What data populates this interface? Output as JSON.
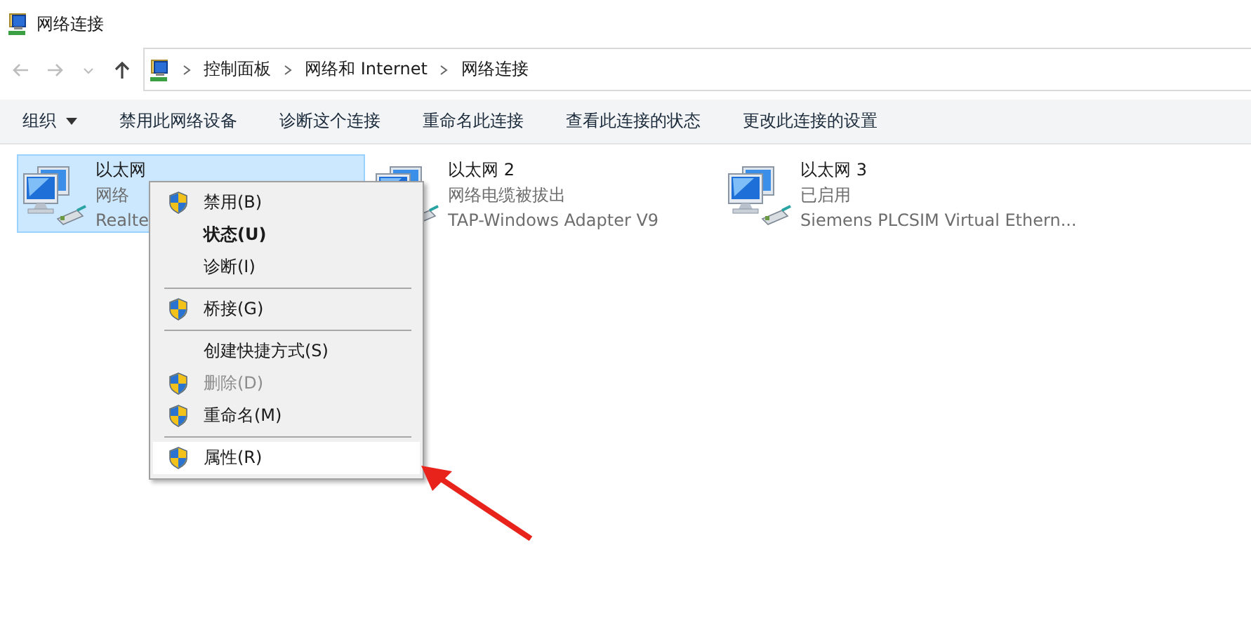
{
  "window": {
    "title": "网络连接"
  },
  "nav": [
    {
      "kind": "back",
      "disabled": true
    },
    {
      "kind": "forward",
      "disabled": true
    },
    {
      "kind": "recent",
      "disabled": true
    },
    {
      "kind": "up",
      "disabled": false
    }
  ],
  "address": {
    "segments": [
      "控制面板",
      "网络和 Internet",
      "网络连接"
    ]
  },
  "toolbar": [
    {
      "label": "组织",
      "kind": "menu"
    },
    {
      "label": "禁用此网络设备",
      "kind": "button"
    },
    {
      "label": "诊断这个连接",
      "kind": "button"
    },
    {
      "label": "重命名此连接",
      "kind": "button"
    },
    {
      "label": "查看此连接的状态",
      "kind": "button"
    },
    {
      "label": "更改此连接的设置",
      "kind": "button"
    }
  ],
  "connections": [
    {
      "name": "以太网",
      "status": "网络",
      "adapter": "Realte",
      "selected": true
    },
    {
      "name": "以太网 2",
      "status": "网络电缆被拔出",
      "adapter": "TAP-Windows Adapter V9",
      "selected": false
    },
    {
      "name": "以太网 3",
      "status": "已启用",
      "adapter": "Siemens PLCSIM Virtual Ethern...",
      "selected": false
    }
  ],
  "context_menu": {
    "items": [
      {
        "kind": "item",
        "label": "禁用(B)",
        "shield": true,
        "bold": false,
        "disabled": false,
        "selected": false
      },
      {
        "kind": "item",
        "label": "状态(U)",
        "shield": false,
        "bold": true,
        "disabled": false,
        "selected": false
      },
      {
        "kind": "item",
        "label": "诊断(I)",
        "shield": false,
        "bold": false,
        "disabled": false,
        "selected": false
      },
      {
        "kind": "separator"
      },
      {
        "kind": "item",
        "label": "桥接(G)",
        "shield": true,
        "bold": false,
        "disabled": false,
        "selected": false
      },
      {
        "kind": "separator"
      },
      {
        "kind": "item",
        "label": "创建快捷方式(S)",
        "shield": false,
        "bold": false,
        "disabled": false,
        "selected": false
      },
      {
        "kind": "item",
        "label": "删除(D)",
        "shield": true,
        "bold": false,
        "disabled": true,
        "selected": false
      },
      {
        "kind": "item",
        "label": "重命名(M)",
        "shield": true,
        "bold": false,
        "disabled": false,
        "selected": false
      },
      {
        "kind": "separator"
      },
      {
        "kind": "item",
        "label": "属性(R)",
        "shield": true,
        "bold": false,
        "disabled": false,
        "selected": true
      }
    ]
  },
  "annotation": {
    "kind": "arrow"
  }
}
